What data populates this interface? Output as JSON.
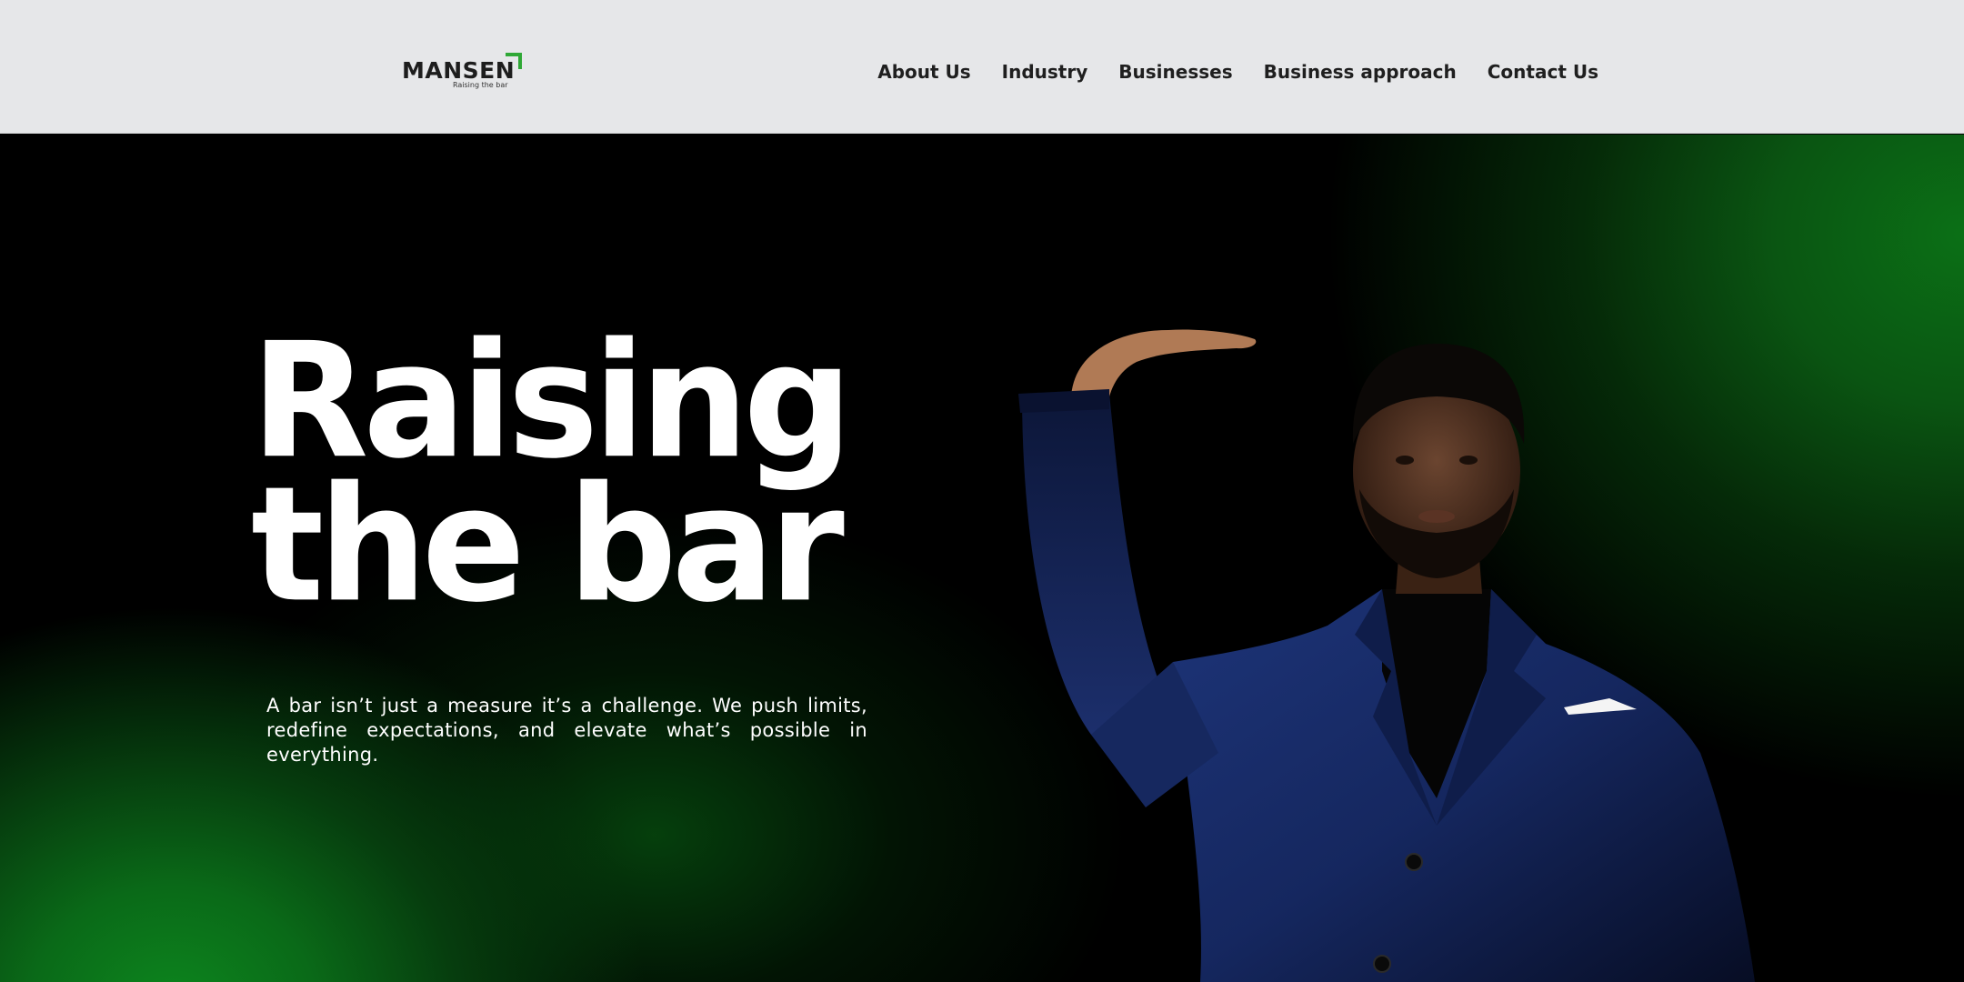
{
  "header": {
    "logo": {
      "word": "MANSEN",
      "tagline": "Raising the bar",
      "accent_color": "#2fa836"
    },
    "nav": [
      {
        "label": "About Us"
      },
      {
        "label": "Industry"
      },
      {
        "label": "Businesses"
      },
      {
        "label": "Business approach"
      },
      {
        "label": "Contact Us"
      }
    ]
  },
  "hero": {
    "headline_line1": "Raising",
    "headline_line2": "the bar",
    "intro": "A bar isn’t just a measure it’s a challenge. We push limits, redefine expectations, and elevate what’s possible in everything.",
    "image_icon": "man-in-suit-raising-hand-image",
    "colors": {
      "background": "#000000",
      "glow": "#0d861e",
      "suit": "#14245a"
    }
  }
}
